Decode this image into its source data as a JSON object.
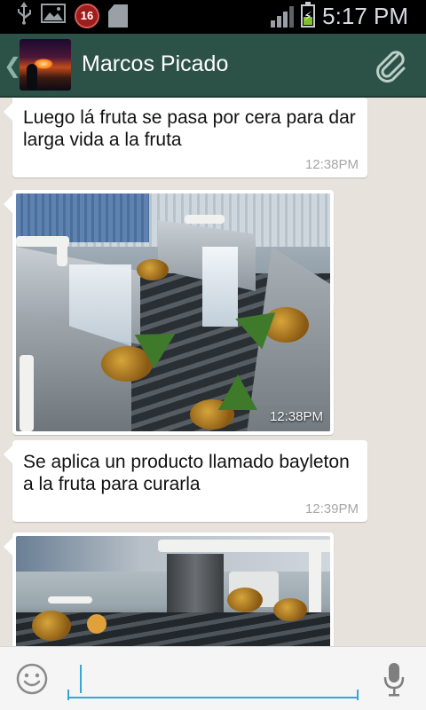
{
  "status_bar": {
    "time": "5:17 PM",
    "notification_count": "16",
    "icons": [
      "usb-icon",
      "image-icon",
      "notification-badge",
      "sd-card-icon",
      "signal-icon",
      "battery-charging-icon"
    ],
    "battery_level": 0.4
  },
  "header": {
    "contact_name": "Marcos Picado",
    "back_icon": "chevron-left-icon",
    "attach_icon": "paperclip-icon"
  },
  "messages": [
    {
      "type": "text",
      "text": "Luego lá fruta se pasa por cera para dar larga vida a la fruta",
      "time": "12:38PM"
    },
    {
      "type": "image",
      "time": "12:38PM"
    },
    {
      "type": "text",
      "text": "Se aplica un producto llamado bayleton a la fruta para curarla",
      "time": "12:39PM"
    },
    {
      "type": "image",
      "time": ""
    }
  ],
  "input": {
    "value": "",
    "placeholder": "",
    "emoji_icon": "emoji-icon",
    "mic_icon": "microphone-icon"
  },
  "colors": {
    "header_bg": "#2c5247",
    "chat_bg": "#e7e3dc",
    "bubble_bg": "#ffffff",
    "accent": "#33a8d6"
  }
}
